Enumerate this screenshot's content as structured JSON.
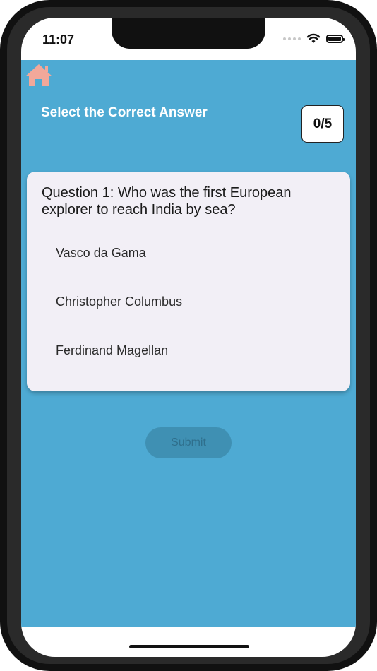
{
  "status_bar": {
    "time": "11:07"
  },
  "header": {
    "title": "Select the Correct Answer",
    "score": "0/5"
  },
  "question": {
    "text": "Question 1: Who was the first European explorer to reach India by sea?",
    "options": [
      "Vasco da Gama",
      "Christopher Columbus",
      "Ferdinand Magellan"
    ]
  },
  "submit_label": "Submit",
  "colors": {
    "background": "#4eaad3",
    "card": "#f2eff6",
    "home_icon": "#f2a89a",
    "submit_disabled": "#3f90b3"
  },
  "icons": [
    "home-icon",
    "wifi-icon",
    "battery-icon",
    "signal-icon"
  ]
}
